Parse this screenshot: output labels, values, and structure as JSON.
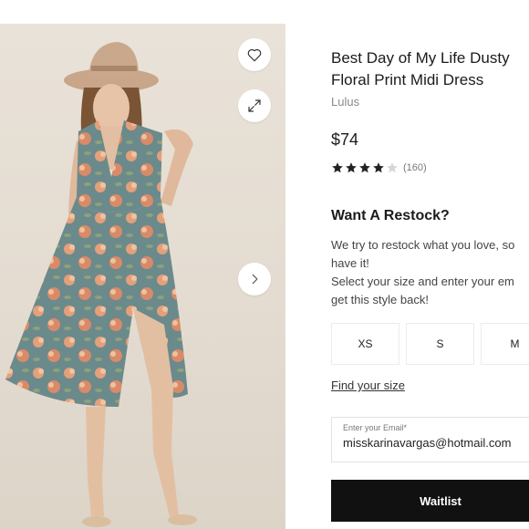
{
  "product": {
    "title_line1": "Best Day of My Life Dusty",
    "title_line2": "Floral Print Midi Dress",
    "brand": "Lulus",
    "price": "$74",
    "rating": {
      "stars_filled": 4,
      "stars_total": 5,
      "count": "(160)"
    }
  },
  "gallery": {
    "favorite_icon": "heart-icon",
    "expand_icon": "expand-icon",
    "next_icon": "chevron-right-icon"
  },
  "restock": {
    "heading": "Want A Restock?",
    "line1": "We try to restock what you love, so",
    "line2": "have it!",
    "line3": "Select your size and enter your em",
    "line4": "get this style back!"
  },
  "sizes": [
    "XS",
    "S",
    "M"
  ],
  "find_size_label": "Find your size",
  "email": {
    "label": "Enter your Email*",
    "value": "misskarinavargas@hotmail.com"
  },
  "waitlist_label": "Waitlist",
  "colors": {
    "dress": "#6b8a8c",
    "floral": "#e7a37c",
    "button_dark": "#111111",
    "star": "#222222"
  }
}
